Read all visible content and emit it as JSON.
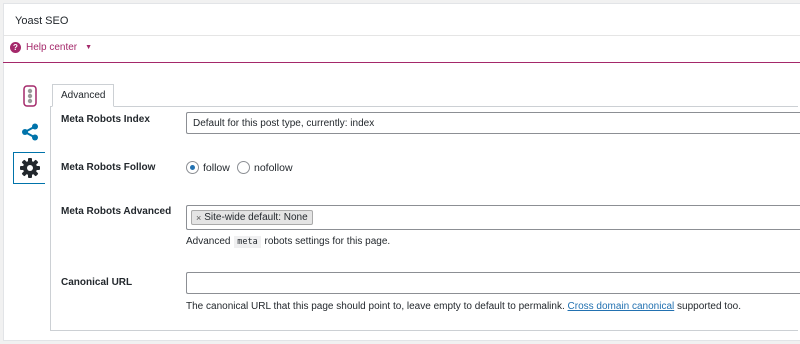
{
  "panel": {
    "title": "Yoast SEO"
  },
  "help": {
    "icon_glyph": "?",
    "label": "Help center",
    "caret": "▼"
  },
  "sidebar": {
    "items": [
      {
        "name": "readability-traffic-light-icon"
      },
      {
        "name": "share-icon"
      },
      {
        "name": "gear-icon",
        "active": true
      }
    ]
  },
  "tabs": [
    {
      "label": "Advanced",
      "active": true
    }
  ],
  "fields": {
    "robots_index": {
      "label": "Meta Robots Index",
      "value": "Default for this post type, currently: index"
    },
    "robots_follow": {
      "label": "Meta Robots Follow",
      "options": [
        {
          "label": "follow",
          "checked": true
        },
        {
          "label": "nofollow",
          "checked": false
        }
      ]
    },
    "robots_advanced": {
      "label": "Meta Robots Advanced",
      "chip_remove": "×",
      "chip_label": "Site-wide default: None",
      "desc_before": "Advanced",
      "desc_code": "meta",
      "desc_after": "robots settings for this page."
    },
    "canonical": {
      "label": "Canonical URL",
      "value": "",
      "desc_before": "The canonical URL that this page should point to, leave empty to default to permalink.",
      "desc_link": "Cross domain canonical",
      "desc_after": "supported too."
    }
  },
  "colors": {
    "brand": "#a4286a",
    "link": "#2271b1",
    "icon_blue": "#0073aa",
    "active_border": "#0073aa"
  }
}
